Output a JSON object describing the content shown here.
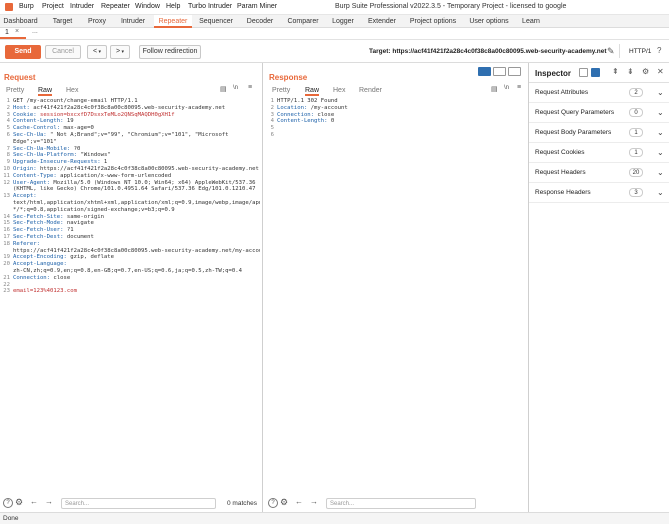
{
  "window": {
    "menu": [
      "Burp",
      "Project",
      "Intruder",
      "Repeater",
      "Window",
      "Help",
      "Turbo Intruder",
      "Param Miner"
    ],
    "title": "Burp Suite Professional v2022.3.5 - Temporary Project - licensed to google"
  },
  "main_tabs": [
    "Dashboard",
    "Target",
    "Proxy",
    "Intruder",
    "Repeater",
    "Sequencer",
    "Decoder",
    "Comparer",
    "Logger",
    "Extender",
    "Project options",
    "User options",
    "Learn"
  ],
  "sub_tabs": {
    "tab1": "1",
    "tab1_close": "×",
    "more": "..."
  },
  "toolbar": {
    "send": "Send",
    "cancel": "Cancel",
    "prev": "<",
    "next": ">",
    "follow": "Follow redirection",
    "target": "Target: https://acf41f421f2a28c4c0f38c8a00c80095.web-security-academy.net",
    "http_version": "HTTP/1"
  },
  "request": {
    "title": "Request",
    "tabs": [
      "Pretty",
      "Raw",
      "Hex"
    ],
    "active_tab": "Raw",
    "lines": [
      {
        "n": "1",
        "k": "",
        "v": "GET /my-account/change-email HTTP/1.1"
      },
      {
        "n": "2",
        "k": "Host:",
        "v": " acf41f421f2a28c4c0f38c8a00c80095.web-security-academy.net"
      },
      {
        "n": "3",
        "k": "Cookie:",
        "v": " session=bxcxfD7DsxxTeMLo2QNSqMAQDH0gXH1f",
        "cookie": true
      },
      {
        "n": "4",
        "k": "Content-Length:",
        "v": " 19"
      },
      {
        "n": "5",
        "k": "Cache-Control:",
        "v": " max-age=0"
      },
      {
        "n": "6",
        "k": "Sec-Ch-Ua:",
        "v": " \" Not A;Brand\";v=\"99\", \"Chromium\";v=\"101\", \"Microsoft"
      },
      {
        "n": "",
        "k": "",
        "v": "Edge\";v=\"101\""
      },
      {
        "n": "7",
        "k": "Sec-Ch-Ua-Mobile:",
        "v": " ?0"
      },
      {
        "n": "8",
        "k": "Sec-Ch-Ua-Platform:",
        "v": " \"Windows\""
      },
      {
        "n": "9",
        "k": "Upgrade-Insecure-Requests:",
        "v": " 1"
      },
      {
        "n": "10",
        "k": "Origin:",
        "v": " https://acf41f421f2a28c4c0f38c8a00c80095.web-security-academy.net"
      },
      {
        "n": "11",
        "k": "Content-Type:",
        "v": " application/x-www-form-urlencoded"
      },
      {
        "n": "12",
        "k": "User-Agent:",
        "v": " Mozilla/5.0 (Windows NT 10.0; Win64; x64) AppleWebKit/537.36"
      },
      {
        "n": "",
        "k": "",
        "v": "(KHTML, like Gecko) Chrome/101.0.4951.64 Safari/537.36 Edg/101.0.1210.47"
      },
      {
        "n": "13",
        "k": "Accept:",
        "v": ""
      },
      {
        "n": "",
        "k": "",
        "v": "text/html,application/xhtml+xml,application/xml;q=0.9,image/webp,image/apng,"
      },
      {
        "n": "",
        "k": "",
        "v": "*/*;q=0.8,application/signed-exchange;v=b3;q=0.9"
      },
      {
        "n": "14",
        "k": "Sec-Fetch-Site:",
        "v": " same-origin"
      },
      {
        "n": "15",
        "k": "Sec-Fetch-Mode:",
        "v": " navigate"
      },
      {
        "n": "16",
        "k": "Sec-Fetch-User:",
        "v": " ?1"
      },
      {
        "n": "17",
        "k": "Sec-Fetch-Dest:",
        "v": " document"
      },
      {
        "n": "18",
        "k": "Referer:",
        "v": ""
      },
      {
        "n": "",
        "k": "",
        "v": "https://acf41f421f2a28c4c0f38c8a00c80095.web-security-academy.net/my-account"
      },
      {
        "n": "19",
        "k": "Accept-Encoding:",
        "v": " gzip, deflate"
      },
      {
        "n": "20",
        "k": "Accept-Language:",
        "v": ""
      },
      {
        "n": "",
        "k": "",
        "v": "zh-CN,zh;q=0.9,en;q=0.8,en-GB;q=0.7,en-US;q=0.6,ja;q=0.5,zh-TW;q=0.4"
      },
      {
        "n": "21",
        "k": "Connection:",
        "v": " close"
      },
      {
        "n": "22",
        "k": "",
        "v": ""
      },
      {
        "n": "23",
        "k": "",
        "v": "email=123%40123.com",
        "body": true
      }
    ],
    "search_placeholder": "Search...",
    "matches": "0 matches"
  },
  "response": {
    "title": "Response",
    "tabs": [
      "Pretty",
      "Raw",
      "Hex",
      "Render"
    ],
    "active_tab": "Raw",
    "lines": [
      {
        "n": "1",
        "k": "",
        "v": "HTTP/1.1 302 Found"
      },
      {
        "n": "2",
        "k": "Location:",
        "v": " /my-account"
      },
      {
        "n": "3",
        "k": "Connection:",
        "v": " close"
      },
      {
        "n": "4",
        "k": "Content-Length:",
        "v": " 0"
      },
      {
        "n": "5",
        "k": "",
        "v": ""
      },
      {
        "n": "6",
        "k": "",
        "v": ""
      }
    ],
    "search_placeholder": "Search..."
  },
  "inspector": {
    "title": "Inspector",
    "items": [
      {
        "label": "Request Attributes",
        "count": "2"
      },
      {
        "label": "Request Query Parameters",
        "count": "0"
      },
      {
        "label": "Request Body Parameters",
        "count": "1"
      },
      {
        "label": "Request Cookies",
        "count": "1"
      },
      {
        "label": "Request Headers",
        "count": "20"
      },
      {
        "label": "Response Headers",
        "count": "3"
      }
    ]
  },
  "status": {
    "text": "Done"
  },
  "colors": {
    "accent": "#e8683a",
    "header_key": "#1a5fa8",
    "highlight": "#c03030"
  }
}
